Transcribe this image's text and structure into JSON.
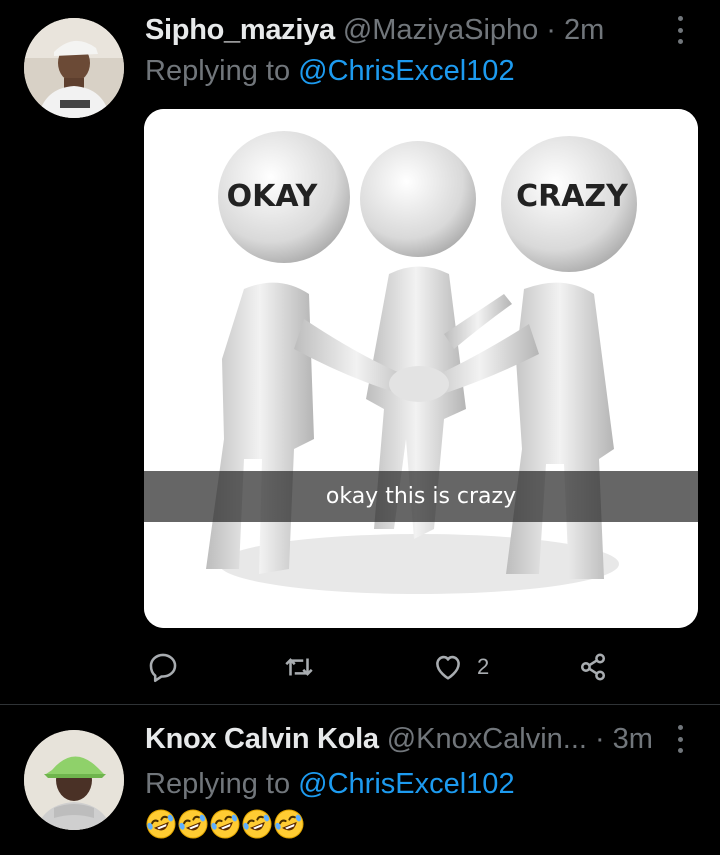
{
  "tweets": [
    {
      "author_name": "Sipho_maziya",
      "handle": "@MaziyaSipho",
      "time": "2m",
      "reply_prefix": "Replying to",
      "reply_mention": "@ChrisExcel102",
      "media": {
        "label_left": "OKAY",
        "label_right": "CRAZY",
        "caption": "okay this is crazy"
      },
      "likes": "2"
    },
    {
      "author_name": "Knox Calvin Kola",
      "handle": "@KnoxCalvin...",
      "time": "3m",
      "reply_prefix": "Replying to",
      "reply_mention": "@ChrisExcel102",
      "emoji_count": 5
    }
  ],
  "separator": "·",
  "colors": {
    "background": "#000000",
    "link": "#1d9bf0",
    "muted": "#71767b"
  },
  "icons": [
    "more-icon",
    "reply-icon",
    "retweet-icon",
    "like-icon",
    "share-icon",
    "rofl-emoji-icon"
  ]
}
